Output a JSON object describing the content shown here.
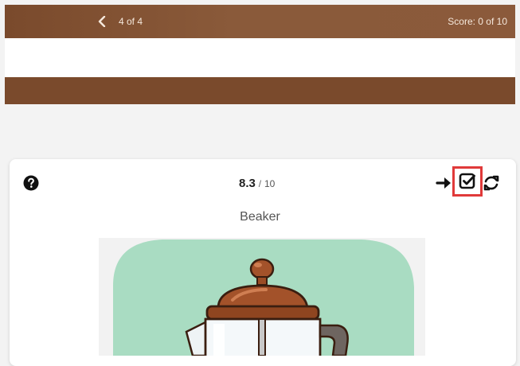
{
  "header": {
    "progress": "4 of 4",
    "score": "Score: 0 of 10"
  },
  "card": {
    "score_value": "8.3",
    "score_sep": "/",
    "score_total": "10",
    "word": "Beaker"
  },
  "icons": {
    "back": "chevron-left-icon",
    "help": "question-circle-icon",
    "next": "arrow-right-icon",
    "check": "check-square-icon",
    "refresh": "refresh-icon"
  },
  "colors": {
    "header_brown": "#8a5a3a",
    "bar_brown": "#7a4a2c",
    "highlight_red": "#e03a3a",
    "illustration_green": "#a9dcc2"
  }
}
